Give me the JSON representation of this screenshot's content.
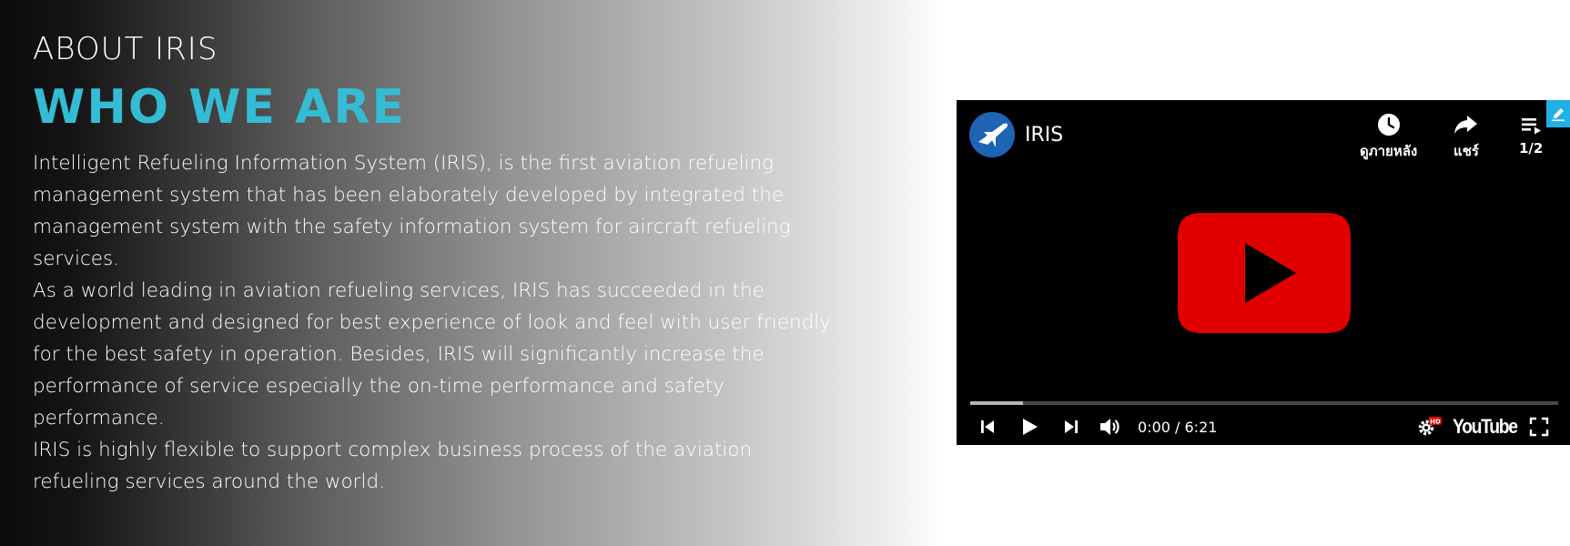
{
  "section": {
    "eyebrow": "ABOUT IRIS",
    "heading": "WHO WE ARE",
    "paragraphs": [
      "Intelligent Refueling Information System (IRIS), is the first aviation refueling management system that has been elaborately developed by integrated the management system with the safety information system for aircraft refueling services.",
      "As a world leading in aviation refueling services, IRIS has succeeded in the development and designed for best experience of look and feel with user friendly for the best safety in operation. Besides, IRIS will significantly increase the performance of service especially the on-time performance and safety performance.",
      "IRIS is highly flexible to support complex business process of the aviation refueling services around the world."
    ]
  },
  "video": {
    "title": "IRIS",
    "watch_later": "ดูภายหลัง",
    "share": "แชร์",
    "playlist": "1/2",
    "time": "0:00 / 6:21",
    "buffered_fraction": 0.09,
    "youtube_label": "YouTube",
    "hd_badge": "HD",
    "icons": [
      "airplane-icon",
      "clock-icon",
      "share-arrow-icon",
      "playlist-icon",
      "play-icon",
      "previous-icon",
      "next-icon",
      "volume-icon",
      "settings-gear-icon",
      "fullscreen-icon",
      "pencil-icon"
    ]
  },
  "colors": {
    "accent": "#34bcd4",
    "youtube_red": "#e00000",
    "edit_tab": "#1eb0e6"
  }
}
